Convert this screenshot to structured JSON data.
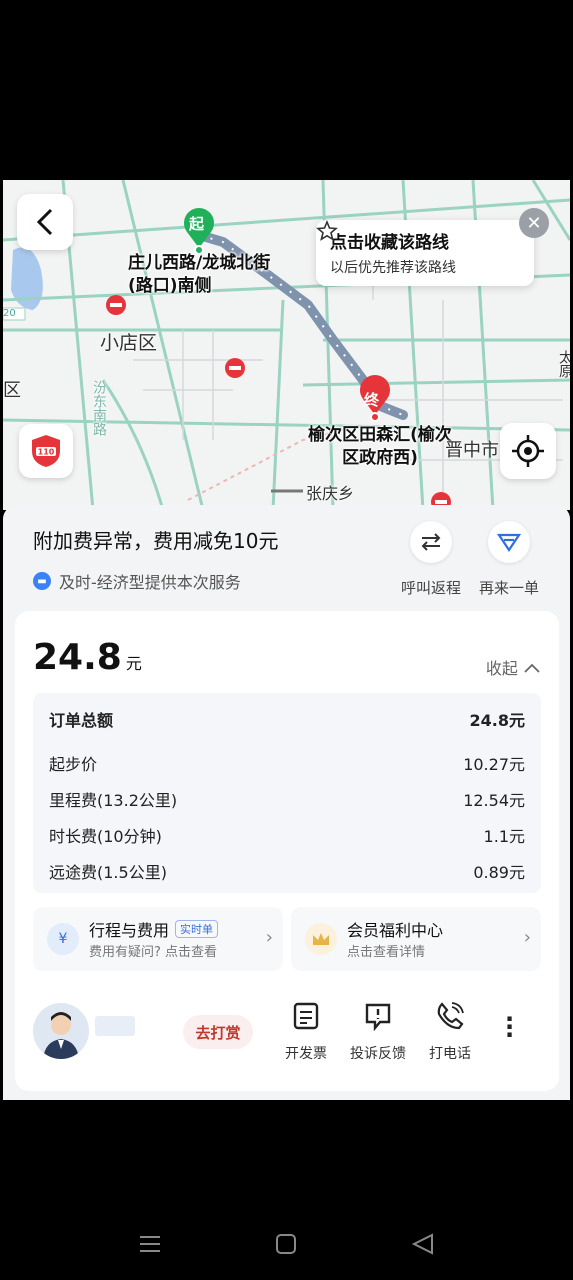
{
  "map": {
    "start_marker": "起",
    "end_marker": "终",
    "start_label": "庄儿西路/龙城北街(路口)南侧",
    "end_label": "榆次区田森汇(榆次区政府西)",
    "district_xiaodian": "小店区",
    "district_jinzhong": "晋中市",
    "town_zhangqing": "张庆乡",
    "road_fendong": "汾东南路",
    "road_tag": "20",
    "edge_left": "区",
    "edge_right": "太原",
    "favorite": {
      "title": "点击收藏该路线",
      "subtitle": "以后优先推荐该路线"
    },
    "police_label": "110"
  },
  "sheet": {
    "notice": "附加费异常，费用减免10元",
    "service": "及时-经济型提供本次服务",
    "actions": [
      {
        "label": "呼叫返程"
      },
      {
        "label": "再来一单"
      }
    ]
  },
  "card": {
    "price": "24.8",
    "price_unit": "元",
    "collapse": "收起",
    "fees": [
      {
        "name": "订单总额",
        "value": "24.8元"
      },
      {
        "name": "起步价",
        "value": "10.27元"
      },
      {
        "name": "里程费(13.2公里)",
        "value": "12.54元"
      },
      {
        "name": "时长费(10分钟)",
        "value": "1.1元"
      },
      {
        "name": "远途费(1.5公里)",
        "value": "0.89元"
      }
    ],
    "trip": {
      "title": "行程与费用",
      "badge": "实时单",
      "subtitle": "费用有疑问? 点击查看",
      "icon": "¥"
    },
    "member": {
      "title": "会员福利中心",
      "subtitle": "点击查看详情"
    },
    "tip": "去打赏",
    "bottom_actions": [
      {
        "label": "开发票"
      },
      {
        "label": "投诉反馈"
      },
      {
        "label": "打电话"
      }
    ]
  },
  "colors": {
    "route": "#7f93ad",
    "start_green": "#1fb15a",
    "end_red": "#e5353a",
    "accent_blue": "#2f6fe0"
  }
}
